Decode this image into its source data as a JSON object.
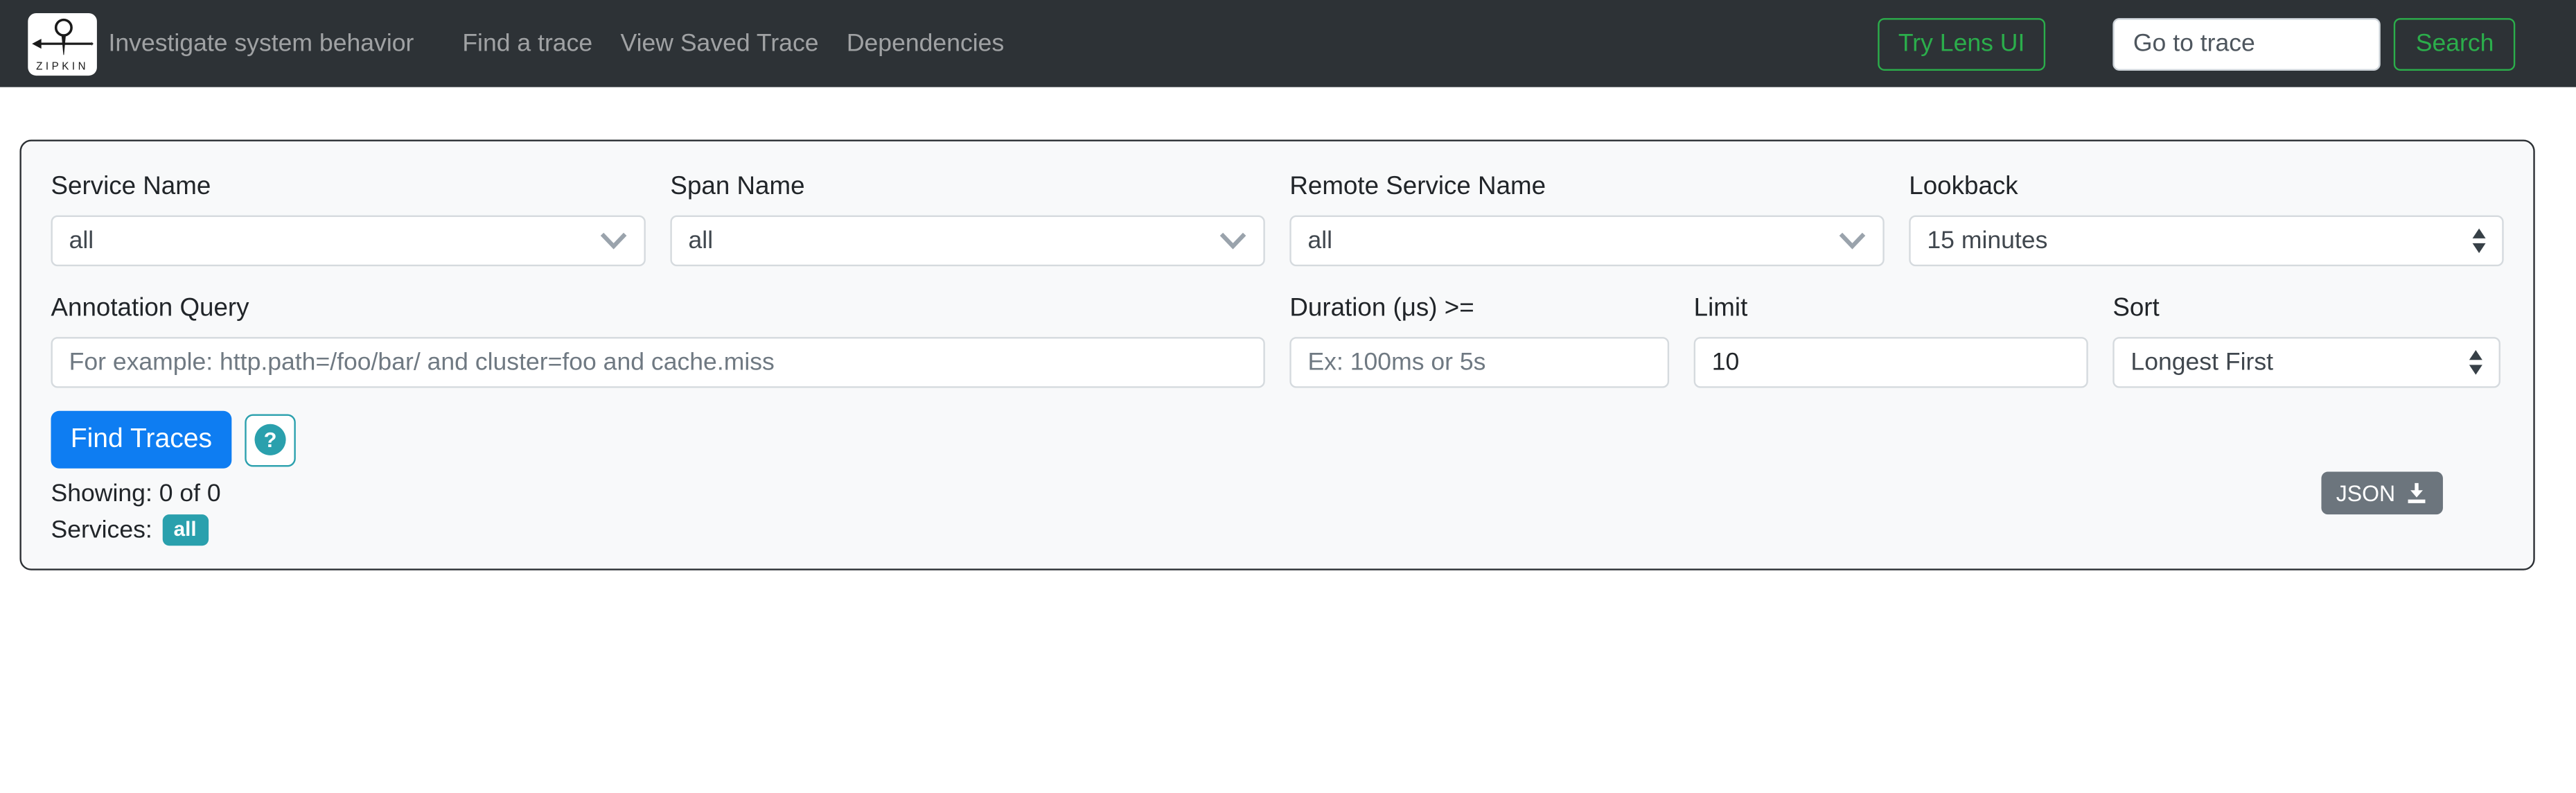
{
  "navbar": {
    "logo_text": "ZIPKIN",
    "tagline": "Investigate system behavior",
    "links": [
      {
        "label": "Find a trace"
      },
      {
        "label": "View Saved Trace"
      },
      {
        "label": "Dependencies"
      }
    ],
    "try_lens_button_label": "Try Lens UI",
    "go_to_trace_placeholder": "Go to trace",
    "search_button_label": "Search"
  },
  "search_form": {
    "service_name": {
      "label": "Service Name",
      "value": "all"
    },
    "span_name": {
      "label": "Span Name",
      "value": "all"
    },
    "remote_service_name": {
      "label": "Remote Service Name",
      "value": "all"
    },
    "lookback": {
      "label": "Lookback",
      "value": "15 minutes"
    },
    "annotation_query": {
      "label": "Annotation Query",
      "value": "",
      "placeholder": "For example: http.path=/foo/bar/ and cluster=foo and cache.miss"
    },
    "duration": {
      "label": "Duration (μs) >=",
      "value": "",
      "placeholder": "Ex: 100ms or 5s"
    },
    "limit": {
      "label": "Limit",
      "value": "10"
    },
    "sort": {
      "label": "Sort",
      "value": "Longest First"
    },
    "find_traces_label": "Find Traces",
    "help_label": "?",
    "showing_text": "Showing: 0 of 0",
    "services_label": "Services:",
    "services_badge": "all",
    "json_button_label": "JSON"
  },
  "colors": {
    "navbar_bg": "#2d3236",
    "accent_green": "#2bae4b",
    "primary_blue": "#0e7df2",
    "teal": "#2aa0ad",
    "json_button_gray": "#6c757d",
    "panel_bg": "#f8f9fa"
  },
  "icons": {
    "logo": "zipkin-needle-icon",
    "select_open": "chevron-down-icon",
    "native_select": "up-down-arrows-icon",
    "help": "question-icon",
    "json": "download-icon"
  }
}
